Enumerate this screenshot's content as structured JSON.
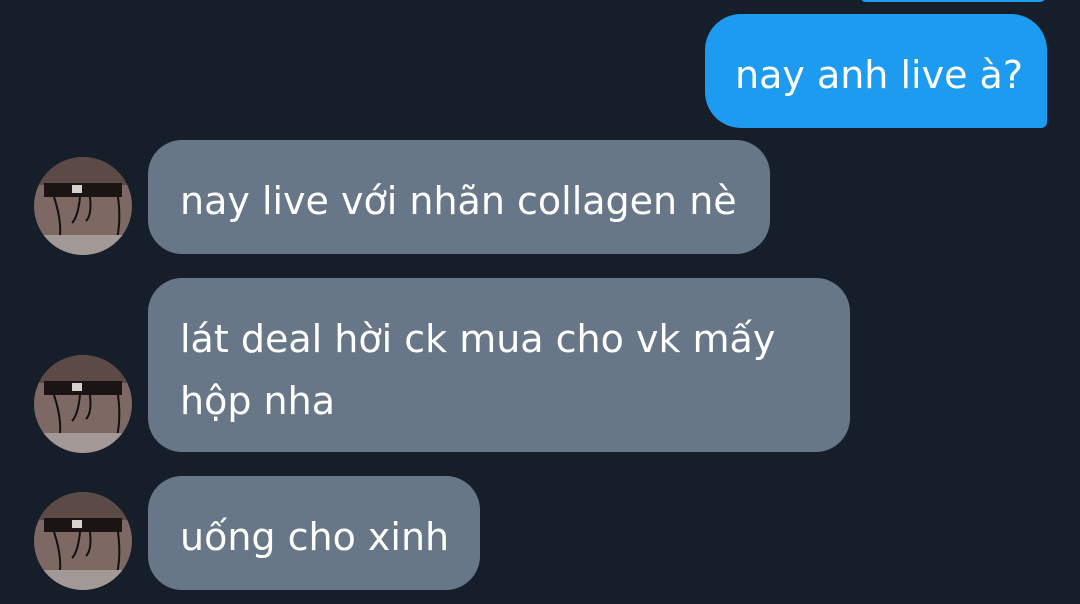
{
  "conversation": {
    "messages": [
      {
        "direction": "outgoing",
        "text": "nay anh live à?"
      },
      {
        "direction": "incoming",
        "text": "nay live với nhãn collagen nè",
        "avatar": "contact-avatar"
      },
      {
        "direction": "incoming",
        "text": "lát deal hời ck mua cho vk mấy hộp nha",
        "avatar": "contact-avatar"
      },
      {
        "direction": "incoming",
        "text": "uống cho xinh",
        "avatar": "contact-avatar"
      }
    ]
  },
  "colors": {
    "background": "#151e29",
    "outgoing_bubble": "#1d9bf0",
    "incoming_bubble": "#687787",
    "text": "#ffffff"
  }
}
